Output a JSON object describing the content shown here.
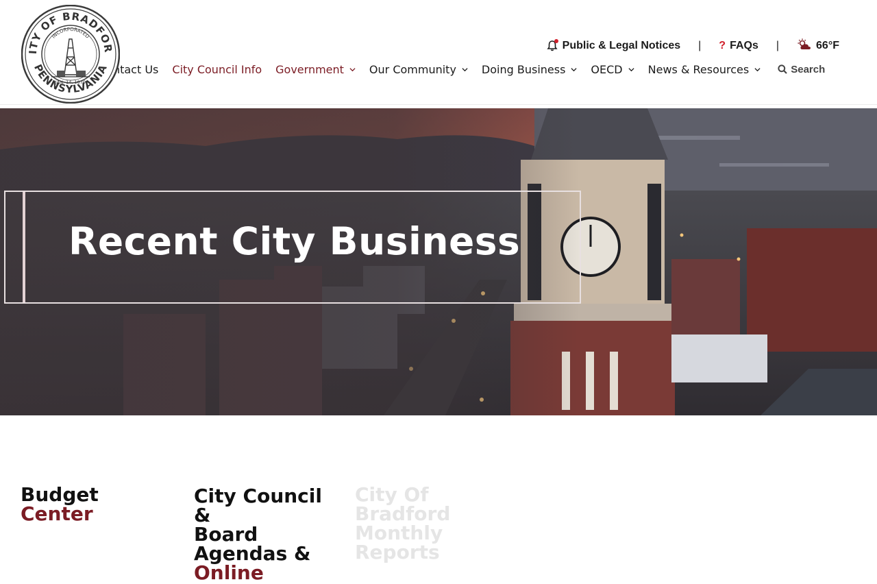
{
  "logo": {
    "top_text": "CITY OF BRADFORD",
    "bottom_text": "PENNSYLVANIA",
    "inner_text": "INCORPORATED",
    "date_text": "JAN. 14, 1879"
  },
  "utility": {
    "notices_label": "Public & Legal Notices",
    "separator": "|",
    "faqs_label": "FAQs",
    "weather_label": "66°F"
  },
  "nav": {
    "items": [
      {
        "label": "Contact Us"
      },
      {
        "label": "City Council Info"
      },
      {
        "label": "Government"
      },
      {
        "label": "Our Community"
      },
      {
        "label": "Doing Business"
      },
      {
        "label": "OECD"
      },
      {
        "label": "News & Resources"
      }
    ],
    "search_label": "Search"
  },
  "hero": {
    "title": "Recent City Business"
  },
  "cards": [
    {
      "line1": "Budget",
      "line2": "Center"
    },
    {
      "line1": "City Council &",
      "line2": "Board",
      "line3": "Agendas &",
      "line4": "Online"
    },
    {
      "line1": "City Of",
      "line2": "Bradford",
      "line3": "Monthly",
      "line4": "Reports"
    }
  ],
  "colors": {
    "accent": "#7b1c24",
    "alert_red": "#d0202b",
    "text": "#1b1b1b"
  }
}
